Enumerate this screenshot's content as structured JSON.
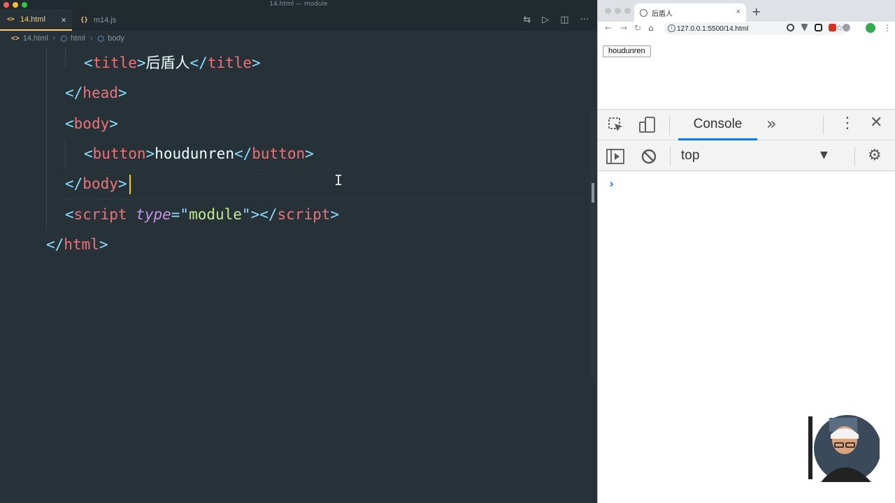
{
  "editor": {
    "window_title": "14.html — module",
    "tabs": [
      {
        "label": "14.html",
        "icon": "<>",
        "close": "×"
      },
      {
        "label": "m14.js",
        "icon": "{}"
      }
    ],
    "breadcrumb": [
      "14.html",
      "html",
      "body"
    ],
    "code_lines": [
      {
        "indent": 2,
        "segments": [
          [
            "punc",
            "<"
          ],
          [
            "tag",
            "title"
          ],
          [
            "punc",
            ">"
          ],
          [
            "txt",
            "后盾人"
          ],
          [
            "punc",
            "</"
          ],
          [
            "tag",
            "title"
          ],
          [
            "punc",
            ">"
          ]
        ]
      },
      {
        "indent": 1,
        "segments": [
          [
            "punc",
            "</"
          ],
          [
            "tag",
            "head"
          ],
          [
            "punc",
            ">"
          ]
        ]
      },
      {
        "indent": 1,
        "segments": [
          [
            "punc",
            "<"
          ],
          [
            "tag",
            "body"
          ],
          [
            "punc",
            ">"
          ]
        ]
      },
      {
        "indent": 2,
        "segments": [
          [
            "punc",
            "<"
          ],
          [
            "tag",
            "button"
          ],
          [
            "punc",
            ">"
          ],
          [
            "txt",
            "houdunren"
          ],
          [
            "punc",
            "</"
          ],
          [
            "tag",
            "button"
          ],
          [
            "punc",
            ">"
          ]
        ]
      },
      {
        "indent": 1,
        "segments": [
          [
            "punc",
            "</"
          ],
          [
            "tag",
            "body"
          ],
          [
            "punc",
            ">"
          ]
        ]
      },
      {
        "indent": 1,
        "segments": [
          [
            "punc",
            "<"
          ],
          [
            "tag",
            "script"
          ],
          [
            "txt",
            " "
          ],
          [
            "attr",
            "type"
          ],
          [
            "punc",
            "="
          ],
          [
            "strq",
            "\""
          ],
          [
            "str",
            "module"
          ],
          [
            "strq",
            "\""
          ],
          [
            "punc",
            "></"
          ],
          [
            "tag",
            "script"
          ],
          [
            "punc",
            ">"
          ]
        ]
      },
      {
        "indent": 0,
        "segments": [
          [
            "punc",
            "</"
          ],
          [
            "tag",
            "html"
          ],
          [
            "punc",
            ">"
          ]
        ]
      }
    ]
  },
  "browser": {
    "tab_title": "后盾人",
    "tab_close": "×",
    "new_tab": "+",
    "url": "127.0.0.1:5500/14.html",
    "page_button_label": "houdunren",
    "devtools": {
      "active_tab": "Console",
      "more_tabs": "»",
      "context": "top",
      "prompt": "›"
    }
  },
  "colors": {
    "editor_bg": "#263238",
    "tag": "#f07178",
    "punctuation": "#89ddff",
    "attribute": "#c792ea",
    "string": "#c3e88d",
    "active_tab": "#ffcb6b",
    "devtools_accent": "#1a73e8"
  }
}
